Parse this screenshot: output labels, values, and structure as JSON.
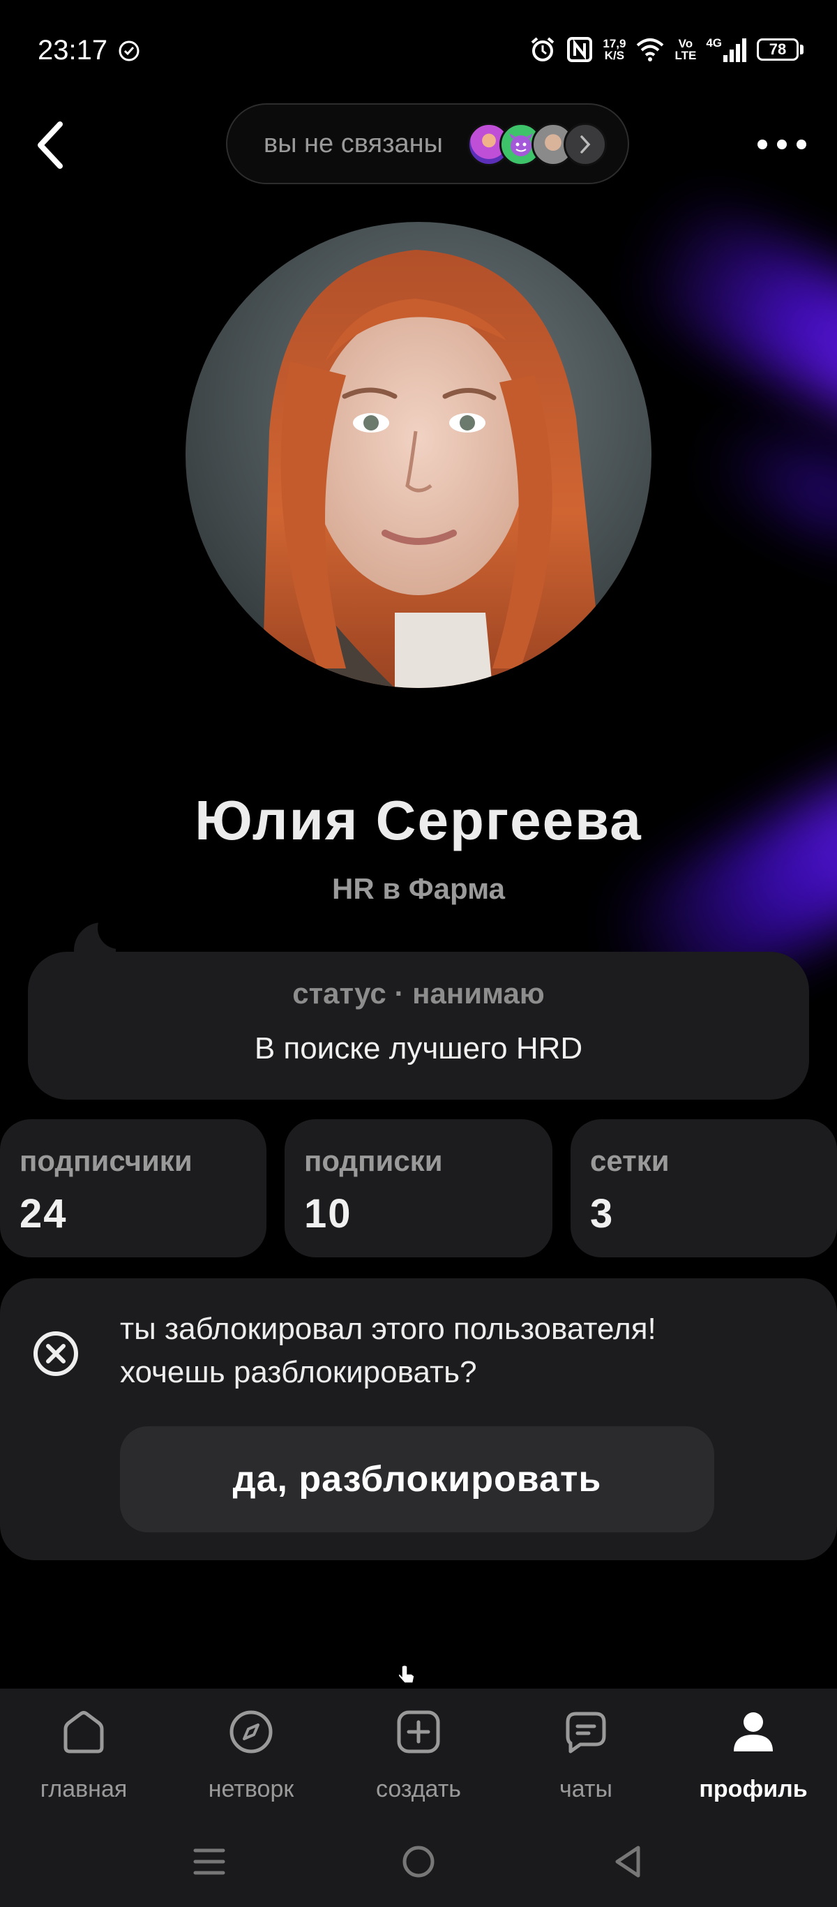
{
  "status_bar": {
    "time": "23:17",
    "net_speed_top": "17,9",
    "net_speed_bottom": "K/S",
    "volte_top": "Vo",
    "volte_bottom": "LTE",
    "network": "4G",
    "battery": "78"
  },
  "header": {
    "connection_text": "вы не связаны"
  },
  "profile": {
    "name": "Юлия Сергеева",
    "subtitle": "HR в Фарма"
  },
  "status": {
    "title": "статус · нанимаю",
    "text": "В поиске лучшего HRD"
  },
  "stats": [
    {
      "label": "подписчики",
      "value": "24"
    },
    {
      "label": "подписки",
      "value": "10"
    },
    {
      "label": "сетки",
      "value": "3"
    }
  ],
  "block_notice": {
    "line1": "ты заблокировал этого пользователя!",
    "line2": "хочешь разблокировать?",
    "button": "да, разблокировать"
  },
  "bottom_nav": [
    {
      "label": "главная",
      "icon": "home-icon"
    },
    {
      "label": "нетворк",
      "icon": "compass-icon"
    },
    {
      "label": "создать",
      "icon": "plus-square-icon"
    },
    {
      "label": "чаты",
      "icon": "chat-icon"
    },
    {
      "label": "профиль",
      "icon": "person-icon",
      "active": true
    }
  ],
  "colors": {
    "background": "#000000",
    "card": "#1c1c1e",
    "glow": "#5a16ef",
    "muted_text": "#9a9a9a"
  }
}
